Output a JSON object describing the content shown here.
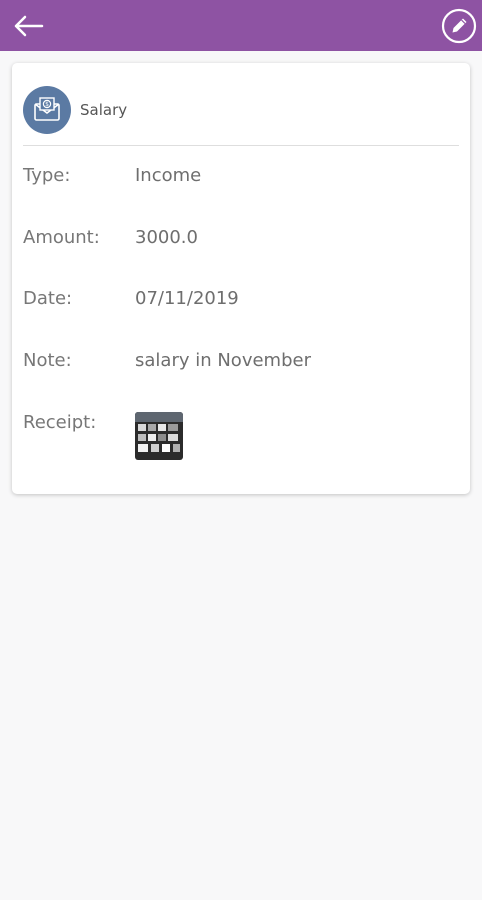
{
  "appbar": {
    "color": "#8e53a3",
    "back_icon": "arrow-left-icon",
    "edit_icon": "pencil-icon"
  },
  "category": {
    "name": "Salary",
    "icon": "money-envelope-icon",
    "icon_color": "#5b7aa3"
  },
  "details": {
    "type_label": "Type:",
    "type_value": "Income",
    "amount_label": "Amount:",
    "amount_value": "3000.0",
    "date_label": "Date:",
    "date_value": "07/11/2019",
    "note_label": "Note:",
    "note_value": "salary in November",
    "receipt_label": "Receipt:"
  }
}
